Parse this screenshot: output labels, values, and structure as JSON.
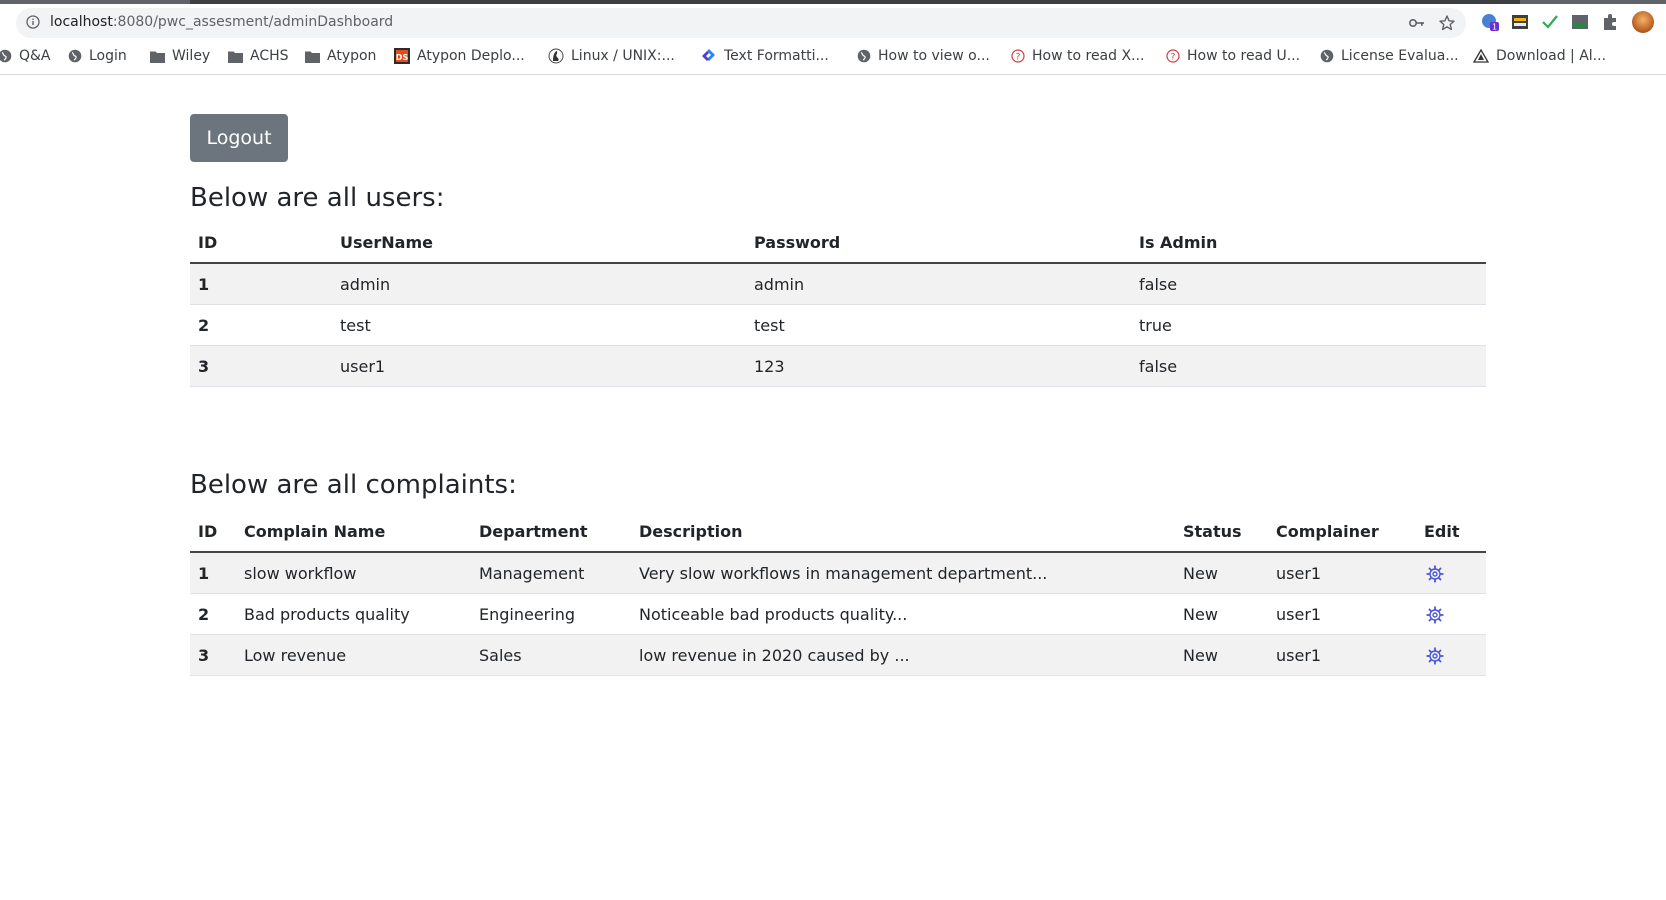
{
  "browser": {
    "url_host": "localhost",
    "url_path": ":8080/pwc_assesment/adminDashboard",
    "extension_badge": "1"
  },
  "bookmarks": [
    {
      "label": "Q&A",
      "icon": "globe-icon"
    },
    {
      "label": "Login",
      "icon": "globe-icon"
    },
    {
      "label": "Wiley",
      "icon": "folder-icon"
    },
    {
      "label": "ACHS",
      "icon": "folder-icon"
    },
    {
      "label": "Atypon",
      "icon": "folder-icon"
    },
    {
      "label": "Atypon Deplo...",
      "icon": "ds-icon"
    },
    {
      "label": "Linux / UNIX:...",
      "icon": "linux-icon"
    },
    {
      "label": "Text Formatti...",
      "icon": "jira-icon"
    },
    {
      "label": "How to view o...",
      "icon": "globe-icon"
    },
    {
      "label": "How to read X...",
      "icon": "help-icon"
    },
    {
      "label": "How to read U...",
      "icon": "help-icon"
    },
    {
      "label": "License Evalua...",
      "icon": "globe-icon"
    },
    {
      "label": "Download | Al...",
      "icon": "download-icon"
    }
  ],
  "logout_label": "Logout",
  "users": {
    "heading": "Below are all users:",
    "headers": [
      "ID",
      "UserName",
      "Password",
      "Is Admin"
    ],
    "rows": [
      [
        "1",
        "admin",
        "admin",
        "false"
      ],
      [
        "2",
        "test",
        "test",
        "true"
      ],
      [
        "3",
        "user1",
        "123",
        "false"
      ]
    ]
  },
  "complaints": {
    "heading": "Below are all complaints:",
    "headers": [
      "ID",
      "Complain Name",
      "Department",
      "Description",
      "Status",
      "Complainer",
      "Edit"
    ],
    "rows": [
      [
        "1",
        "slow workflow",
        "Management",
        "Very slow workflows in management department...",
        "New",
        "user1"
      ],
      [
        "2",
        "Bad products quality",
        "Engineering",
        "Noticeable bad products quality...",
        "New",
        "user1"
      ],
      [
        "3",
        "Low revenue",
        "Sales",
        "low revenue in 2020 caused by ...",
        "New",
        "user1"
      ]
    ]
  },
  "colors": {
    "logout_bg": "#6c757d",
    "edit_icon": "#4b55d6",
    "row_stripe": "#f2f2f2"
  }
}
